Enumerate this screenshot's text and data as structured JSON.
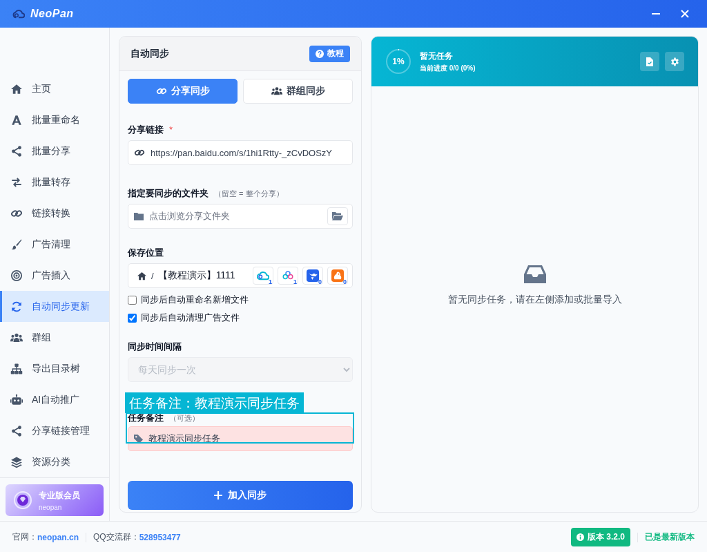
{
  "window": {
    "title": "NeoPan"
  },
  "sidebar": {
    "items": [
      {
        "label": "主页",
        "selected": false
      },
      {
        "label": "批量重命名",
        "selected": false
      },
      {
        "label": "批量分享",
        "selected": false
      },
      {
        "label": "批量转存",
        "selected": false
      },
      {
        "label": "链接转换",
        "selected": false
      },
      {
        "label": "广告清理",
        "selected": false
      },
      {
        "label": "广告插入",
        "selected": false
      },
      {
        "label": "自动同步更新",
        "selected": true
      },
      {
        "label": "群组",
        "selected": false
      },
      {
        "label": "导出目录树",
        "selected": false
      },
      {
        "label": "AI自动推广",
        "selected": false
      },
      {
        "label": "分享链接管理",
        "selected": false
      },
      {
        "label": "资源分类",
        "selected": false
      }
    ],
    "pro": {
      "title": "专业版会员",
      "subtitle": "neopan"
    }
  },
  "sync_form": {
    "title": "自动同步",
    "help_button": "教程",
    "tabs": [
      {
        "label": "分享同步",
        "selected": true
      },
      {
        "label": "群组同步",
        "selected": false
      }
    ],
    "share_link": {
      "label": "分享链接",
      "required_mark": "*",
      "value": "https://pan.baidu.com/s/1hi1Rtty-_zCvDOSzY"
    },
    "folder": {
      "label": "指定要同步的文件夹",
      "hint": "（留空 = 整个分享）",
      "placeholder": "点击浏览分享文件夹"
    },
    "save_location": {
      "label": "保存位置",
      "separator": "/",
      "path": "【教程演示】1111",
      "drives": [
        {
          "kind": "cloud",
          "count": "1"
        },
        {
          "kind": "rings",
          "count": "1"
        },
        {
          "kind": "bird",
          "count": "0"
        },
        {
          "kind": "squirrel",
          "count": "0"
        }
      ]
    },
    "options": [
      {
        "label": "同步后自动重命名新增文件",
        "checked": false
      },
      {
        "label": "同步后自动清理广告文件",
        "checked": true
      }
    ],
    "interval": {
      "label": "同步时间间隔",
      "value": "每天同步一次",
      "disabled": true
    },
    "caption": "任务备注：教程演示同步任务",
    "note": {
      "label": "任务备注",
      "hint": "（可选）",
      "value": "教程演示同步任务"
    },
    "submit": "加入同步"
  },
  "task_panel": {
    "progress": {
      "reading": "1%",
      "level": 0.01
    },
    "title": "暂无任务",
    "subtitle": "当前进度 0/0 (0%)",
    "empty_text": "暂无同步任务，请在左侧添加或批量导入"
  },
  "status_bar": {
    "site_label": "官网：",
    "site_link": "neopan.cn",
    "qq_label": "QQ交流群：",
    "qq_number": "528953477",
    "version": "版本 3.2.0",
    "update_status": "已是最新版本"
  }
}
